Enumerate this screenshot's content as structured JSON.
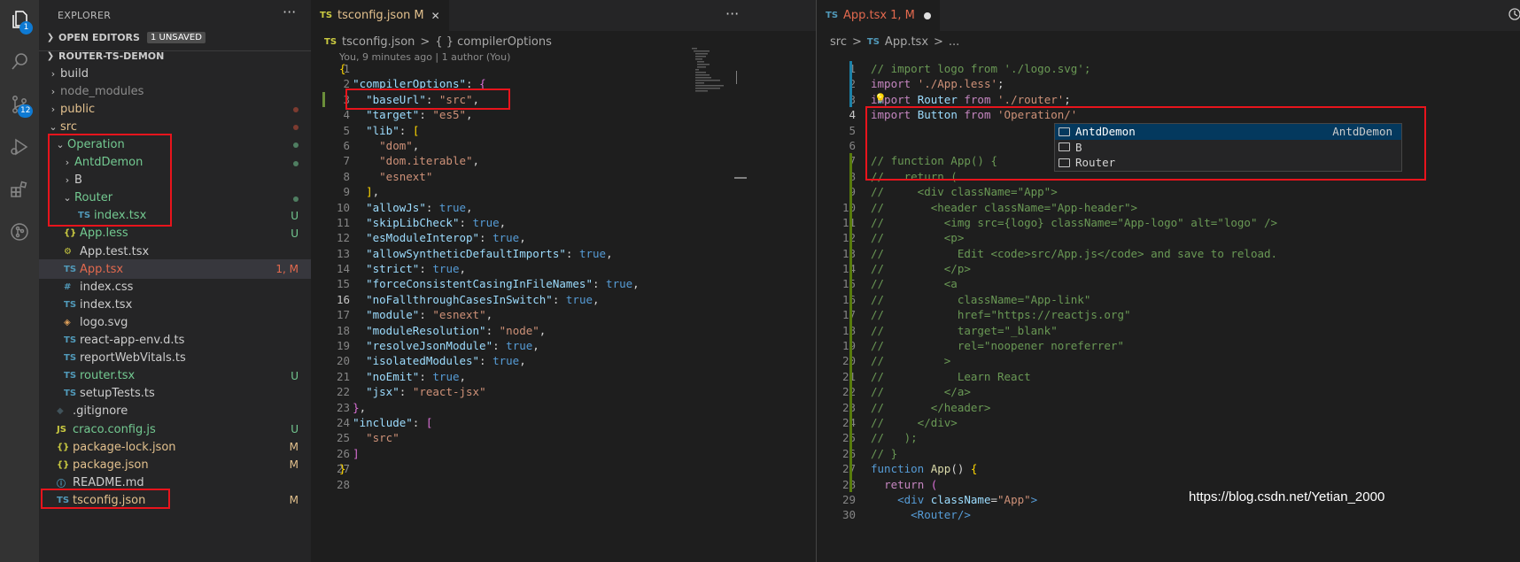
{
  "activity": {
    "explorer_badge": "1",
    "scm_badge": "12"
  },
  "sidebar": {
    "title": "EXPLORER",
    "more": "···",
    "open_editors": "OPEN EDITORS",
    "unsaved": "1 UNSAVED",
    "project": "ROUTER-TS-DEMON",
    "items": [
      {
        "name": "build",
        "icon": "",
        "type": "folder",
        "open": false,
        "depth": 1,
        "color": "#cccccc",
        "status": ""
      },
      {
        "name": "node_modules",
        "icon": "",
        "type": "folder",
        "open": false,
        "depth": 1,
        "color": "#8c8c8c",
        "status": ""
      },
      {
        "name": "public",
        "icon": "",
        "type": "folder",
        "open": false,
        "depth": 1,
        "color": "#e2c08d",
        "status": "dot-red"
      },
      {
        "name": "src",
        "icon": "",
        "type": "folder",
        "open": true,
        "depth": 1,
        "color": "#e2c08d",
        "status": "dot-red"
      },
      {
        "name": "Operation",
        "icon": "",
        "type": "folder",
        "open": true,
        "depth": 2,
        "color": "#73c991",
        "status": "dot"
      },
      {
        "name": "AntdDemon",
        "icon": "",
        "type": "folder",
        "open": false,
        "depth": 3,
        "color": "#73c991",
        "status": "dot"
      },
      {
        "name": "B",
        "icon": "",
        "type": "folder",
        "open": false,
        "depth": 3,
        "color": "#cccccc",
        "status": ""
      },
      {
        "name": "Router",
        "icon": "",
        "type": "folder",
        "open": true,
        "depth": 3,
        "color": "#73c991",
        "status": "dot"
      },
      {
        "name": "index.tsx",
        "icon": "TS",
        "type": "file",
        "depth": 4,
        "color": "#73c991",
        "status": "U"
      },
      {
        "name": "App.less",
        "icon": "{}",
        "type": "file",
        "depth": 2,
        "color": "#73c991",
        "status": "U"
      },
      {
        "name": "App.test.tsx",
        "icon": "⚙",
        "type": "file",
        "depth": 2,
        "color": "#cccccc",
        "status": ""
      },
      {
        "name": "App.tsx",
        "icon": "TS",
        "type": "file",
        "depth": 2,
        "color": "#e2694e",
        "status": "1, M",
        "selected": true
      },
      {
        "name": "index.css",
        "icon": "#",
        "type": "file",
        "depth": 2,
        "color": "#cccccc",
        "status": ""
      },
      {
        "name": "index.tsx",
        "icon": "TS",
        "type": "file",
        "depth": 2,
        "color": "#cccccc",
        "status": ""
      },
      {
        "name": "logo.svg",
        "icon": "◈",
        "type": "file",
        "depth": 2,
        "color": "#cccccc",
        "status": ""
      },
      {
        "name": "react-app-env.d.ts",
        "icon": "TS",
        "type": "file",
        "depth": 2,
        "color": "#cccccc",
        "status": ""
      },
      {
        "name": "reportWebVitals.ts",
        "icon": "TS",
        "type": "file",
        "depth": 2,
        "color": "#cccccc",
        "status": ""
      },
      {
        "name": "router.tsx",
        "icon": "TS",
        "type": "file",
        "depth": 2,
        "color": "#73c991",
        "status": "U"
      },
      {
        "name": "setupTests.ts",
        "icon": "TS",
        "type": "file",
        "depth": 2,
        "color": "#cccccc",
        "status": ""
      },
      {
        "name": ".gitignore",
        "icon": "◆",
        "type": "file",
        "depth": 1,
        "color": "#cccccc",
        "status": ""
      },
      {
        "name": "craco.config.js",
        "icon": "JS",
        "type": "file",
        "depth": 1,
        "color": "#73c991",
        "status": "U"
      },
      {
        "name": "package-lock.json",
        "icon": "{}",
        "type": "file",
        "depth": 1,
        "color": "#e2c08d",
        "status": "M"
      },
      {
        "name": "package.json",
        "icon": "{}",
        "type": "file",
        "depth": 1,
        "color": "#e2c08d",
        "status": "M"
      },
      {
        "name": "README.md",
        "icon": "ⓘ",
        "type": "file",
        "depth": 1,
        "color": "#cccccc",
        "status": ""
      },
      {
        "name": "tsconfig.json",
        "icon": "TS",
        "type": "file",
        "depth": 1,
        "color": "#e2c08d",
        "status": "M"
      }
    ]
  },
  "editor1": {
    "tab": {
      "name": "tsconfig.json",
      "mod": "M",
      "close": "✕"
    },
    "more": "···",
    "breadcrumb": {
      "file": "tsconfig.json",
      "sep": ">",
      "symbol": "{ } compilerOptions"
    },
    "blame": "You, 9 minutes ago | 1 author (You)",
    "lines": [
      [
        [
          "{",
          "b"
        ]
      ],
      [
        [
          "  ",
          ""
        ],
        [
          "\"compilerOptions\"",
          "pr"
        ],
        [
          ": ",
          ""
        ],
        [
          "{",
          "b2"
        ]
      ],
      [
        [
          "    ",
          ""
        ],
        [
          "\"baseUrl\"",
          "pr"
        ],
        [
          ": ",
          ""
        ],
        [
          "\"src\"",
          "s"
        ],
        [
          ",",
          ""
        ]
      ],
      [
        [
          "    ",
          ""
        ],
        [
          "\"target\"",
          "pr"
        ],
        [
          ": ",
          ""
        ],
        [
          "\"es5\"",
          "s"
        ],
        [
          ",",
          ""
        ]
      ],
      [
        [
          "    ",
          ""
        ],
        [
          "\"lib\"",
          "pr"
        ],
        [
          ": ",
          ""
        ],
        [
          "[",
          "b"
        ]
      ],
      [
        [
          "      ",
          ""
        ],
        [
          "\"dom\"",
          "s"
        ],
        [
          ",",
          ""
        ]
      ],
      [
        [
          "      ",
          ""
        ],
        [
          "\"dom.iterable\"",
          "s"
        ],
        [
          ",",
          ""
        ]
      ],
      [
        [
          "      ",
          ""
        ],
        [
          "\"esnext\"",
          "s"
        ]
      ],
      [
        [
          "    ",
          ""
        ],
        [
          "]",
          "b"
        ],
        [
          ",",
          ""
        ]
      ],
      [
        [
          "    ",
          ""
        ],
        [
          "\"allowJs\"",
          "pr"
        ],
        [
          ": ",
          ""
        ],
        [
          "true",
          "k"
        ],
        [
          ",",
          ""
        ]
      ],
      [
        [
          "    ",
          ""
        ],
        [
          "\"skipLibCheck\"",
          "pr"
        ],
        [
          ": ",
          ""
        ],
        [
          "true",
          "k"
        ],
        [
          ",",
          ""
        ]
      ],
      [
        [
          "    ",
          ""
        ],
        [
          "\"esModuleInterop\"",
          "pr"
        ],
        [
          ": ",
          ""
        ],
        [
          "true",
          "k"
        ],
        [
          ",",
          ""
        ]
      ],
      [
        [
          "    ",
          ""
        ],
        [
          "\"allowSyntheticDefaultImports\"",
          "pr"
        ],
        [
          ": ",
          ""
        ],
        [
          "true",
          "k"
        ],
        [
          ",",
          ""
        ]
      ],
      [
        [
          "    ",
          ""
        ],
        [
          "\"strict\"",
          "pr"
        ],
        [
          ": ",
          ""
        ],
        [
          "true",
          "k"
        ],
        [
          ",",
          ""
        ]
      ],
      [
        [
          "    ",
          ""
        ],
        [
          "\"forceConsistentCasingInFileNames\"",
          "pr"
        ],
        [
          ": ",
          ""
        ],
        [
          "true",
          "k"
        ],
        [
          ",",
          ""
        ]
      ],
      [
        [
          "    ",
          ""
        ],
        [
          "\"noFallthroughCasesInSwitch\"",
          "pr"
        ],
        [
          ": ",
          ""
        ],
        [
          "true",
          "k"
        ],
        [
          ",",
          ""
        ]
      ],
      [
        [
          "    ",
          ""
        ],
        [
          "\"module\"",
          "pr"
        ],
        [
          ": ",
          ""
        ],
        [
          "\"esnext\"",
          "s"
        ],
        [
          ",",
          ""
        ]
      ],
      [
        [
          "    ",
          ""
        ],
        [
          "\"moduleResolution\"",
          "pr"
        ],
        [
          ": ",
          ""
        ],
        [
          "\"node\"",
          "s"
        ],
        [
          ",",
          ""
        ]
      ],
      [
        [
          "    ",
          ""
        ],
        [
          "\"resolveJsonModule\"",
          "pr"
        ],
        [
          ": ",
          ""
        ],
        [
          "true",
          "k"
        ],
        [
          ",",
          ""
        ]
      ],
      [
        [
          "    ",
          ""
        ],
        [
          "\"isolatedModules\"",
          "pr"
        ],
        [
          ": ",
          ""
        ],
        [
          "true",
          "k"
        ],
        [
          ",",
          ""
        ]
      ],
      [
        [
          "    ",
          ""
        ],
        [
          "\"noEmit\"",
          "pr"
        ],
        [
          ": ",
          ""
        ],
        [
          "true",
          "k"
        ],
        [
          ",",
          ""
        ]
      ],
      [
        [
          "    ",
          ""
        ],
        [
          "\"jsx\"",
          "pr"
        ],
        [
          ": ",
          ""
        ],
        [
          "\"react-jsx\"",
          "s"
        ]
      ],
      [
        [
          "  ",
          ""
        ],
        [
          "}",
          "b2"
        ],
        [
          ",",
          ""
        ]
      ],
      [
        [
          "  ",
          ""
        ],
        [
          "\"include\"",
          "pr"
        ],
        [
          ": ",
          ""
        ],
        [
          "[",
          "b2"
        ]
      ],
      [
        [
          "    ",
          ""
        ],
        [
          "\"src\"",
          "s"
        ]
      ],
      [
        [
          "  ",
          ""
        ],
        [
          "]",
          "b2"
        ]
      ],
      [
        [
          "}",
          "b"
        ]
      ],
      []
    ],
    "current_line": 16
  },
  "editor2": {
    "tab": {
      "name": "App.tsx",
      "mod": "1, M"
    },
    "breadcrumb": {
      "folder": "src",
      "sep": ">",
      "file": "App.tsx",
      "rest": "..."
    },
    "lines": [
      [
        [
          "// import logo from './logo.svg';",
          "c"
        ]
      ],
      [
        [
          "import ",
          "kw"
        ],
        [
          "'./App.less'",
          "s"
        ],
        [
          ";",
          ""
        ]
      ],
      [
        [
          "import ",
          "kw"
        ],
        [
          "Router ",
          "pr"
        ],
        [
          "from ",
          "kw"
        ],
        [
          "'./router'",
          "s"
        ],
        [
          ";",
          ""
        ]
      ],
      [
        [
          "import ",
          "kw"
        ],
        [
          "Button ",
          "pr"
        ],
        [
          "from ",
          "kw"
        ],
        [
          "'Operation/'",
          "s"
        ]
      ],
      [],
      [],
      [
        [
          "// function App() {",
          "c"
        ]
      ],
      [
        [
          "//   return (",
          "c"
        ]
      ],
      [
        [
          "//     <div className=\"App\">",
          "c"
        ]
      ],
      [
        [
          "//       <header className=\"App-header\">",
          "c"
        ]
      ],
      [
        [
          "//         <img src={logo} className=\"App-logo\" alt=\"logo\" />",
          "c"
        ]
      ],
      [
        [
          "//         <p>",
          "c"
        ]
      ],
      [
        [
          "//           Edit <code>src/App.js</code> and save to reload.",
          "c"
        ]
      ],
      [
        [
          "//         </p>",
          "c"
        ]
      ],
      [
        [
          "//         <a",
          "c"
        ]
      ],
      [
        [
          "//           className=\"App-link\"",
          "c"
        ]
      ],
      [
        [
          "//           href=\"https://reactjs.org\"",
          "c"
        ]
      ],
      [
        [
          "//           target=\"_blank\"",
          "c"
        ]
      ],
      [
        [
          "//           rel=\"noopener noreferrer\"",
          "c"
        ]
      ],
      [
        [
          "//         >",
          "c"
        ]
      ],
      [
        [
          "//           Learn React",
          "c"
        ]
      ],
      [
        [
          "//         </a>",
          "c"
        ]
      ],
      [
        [
          "//       </header>",
          "c"
        ]
      ],
      [
        [
          "//     </div>",
          "c"
        ]
      ],
      [
        [
          "//   );",
          "c"
        ]
      ],
      [
        [
          "// }",
          "c"
        ]
      ],
      [
        [
          "function ",
          "k"
        ],
        [
          "App",
          "f"
        ],
        [
          "() ",
          ""
        ],
        [
          "{",
          "b"
        ]
      ],
      [
        [
          "  ",
          ""
        ],
        [
          "return ",
          "kw"
        ],
        [
          "(",
          "b2"
        ]
      ],
      [
        [
          "    ",
          ""
        ],
        [
          "<",
          "k"
        ],
        [
          "div ",
          "k"
        ],
        [
          "className",
          "pr"
        ],
        [
          "=",
          ""
        ],
        [
          "\"App\"",
          "s"
        ],
        [
          ">",
          "k"
        ]
      ],
      [
        [
          "      <Router/>",
          "k"
        ]
      ]
    ],
    "current_line": 4,
    "suggest": [
      {
        "label": "AntdDemon",
        "detail": "AntdDemon",
        "active": true
      },
      {
        "label": "B",
        "detail": "",
        "active": false
      },
      {
        "label": "Router",
        "detail": "",
        "active": false
      }
    ]
  },
  "watermark": "https://blog.csdn.net/Yetian_2000"
}
